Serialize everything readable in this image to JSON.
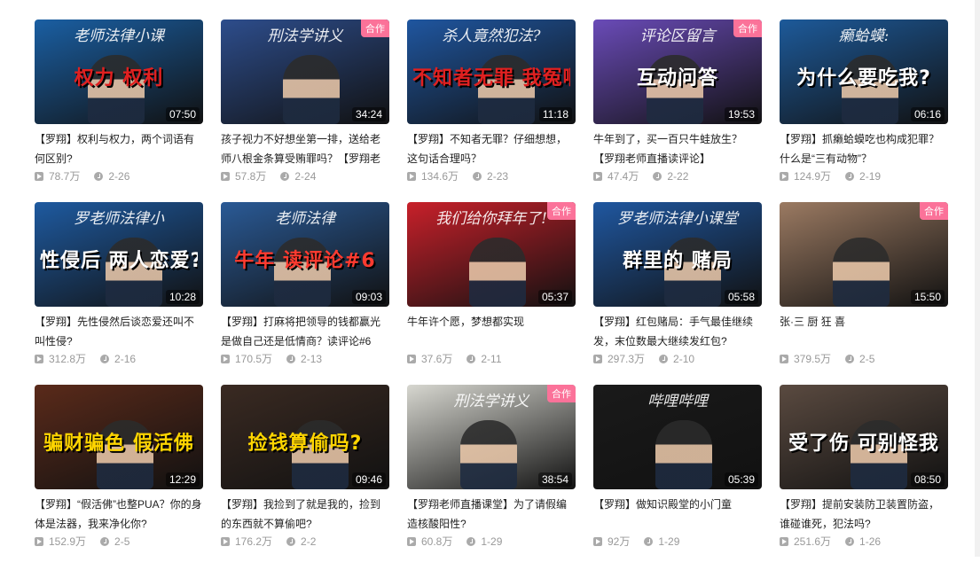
{
  "videos": [
    {
      "thumb_text_top": "老师法律小课",
      "thumb_caption": "权力  权利",
      "badge": "",
      "duration": "07:50",
      "title": "【罗翔】权利与权力，两个词语有何区别?",
      "views": "78.7万",
      "date": "2-26",
      "bg": "#1a5fa3",
      "cap_color": "#e02020"
    },
    {
      "thumb_text_top": "刑法学讲义",
      "thumb_caption": "",
      "badge": "合作",
      "duration": "34:24",
      "title": "孩子视力不好想坐第一排，送给老师八根金条算受贿罪吗？【罗翔老",
      "views": "57.8万",
      "date": "2-24",
      "bg": "#2d4d8c",
      "cap_color": "#ffffff"
    },
    {
      "thumb_text_top": "杀人竟然犯法?",
      "thumb_caption": "不知者无罪 我冤啊",
      "badge": "",
      "duration": "11:18",
      "title": "【罗翔】不知者无罪？仔细想想，这句话合理吗？",
      "views": "134.6万",
      "date": "2-23",
      "bg": "#1f56a0",
      "cap_color": "#e02020"
    },
    {
      "thumb_text_top": "评论区留言",
      "thumb_caption": "互动问答",
      "badge": "合作",
      "duration": "19:53",
      "title": "牛年到了，买一百只牛蛙放生？【罗翔老师直播读评论】",
      "views": "47.4万",
      "date": "2-22",
      "bg": "#6a4bb8",
      "cap_color": "#ffffff"
    },
    {
      "thumb_text_top": "癞蛤蟆:",
      "thumb_caption": "为什么要吃我?",
      "badge": "",
      "duration": "06:16",
      "title": "【罗翔】抓癞蛤蟆吃也构成犯罪？什么是“三有动物”？",
      "views": "124.9万",
      "date": "2-19",
      "bg": "#1d5a9a",
      "cap_color": "#ffffff"
    },
    {
      "thumb_text_top": "罗老师法律小",
      "thumb_caption": "性侵后 两人恋爱?",
      "badge": "",
      "duration": "10:28",
      "title": "【罗翔】先性侵然后谈恋爱还叫不叫性侵?",
      "views": "312.8万",
      "date": "2-16",
      "bg": "#1e5aa0",
      "cap_color": "#ffffff"
    },
    {
      "thumb_text_top": "老师法律",
      "thumb_caption": "牛年 读评论#6",
      "badge": "",
      "duration": "09:03",
      "title": "【罗翔】打麻将把领导的钱都赢光是做自己还是低情商？读评论#6",
      "views": "170.5万",
      "date": "2-13",
      "bg": "#2a5a96",
      "cap_color": "#ff3b30"
    },
    {
      "thumb_text_top": "我们给你拜年了!",
      "thumb_caption": "",
      "badge": "合作",
      "duration": "05:37",
      "title": "牛年许个愿，梦想都实现",
      "views": "37.6万",
      "date": "2-11",
      "bg": "#c8202a",
      "cap_color": "#ffe14a"
    },
    {
      "thumb_text_top": "罗老师法律小课堂",
      "thumb_caption": "群里的 赌局",
      "badge": "",
      "duration": "05:58",
      "title": "【罗翔】红包赌局：手气最佳继续发，末位数最大继续发红包?",
      "views": "297.3万",
      "date": "2-10",
      "bg": "#1f57a0",
      "cap_color": "#ffffff"
    },
    {
      "thumb_text_top": "",
      "thumb_caption": "",
      "badge": "合作",
      "duration": "15:50",
      "title": "张·三 厨 狂 喜",
      "views": "379.5万",
      "date": "2-5",
      "bg": "#9b7a62",
      "cap_color": "#ffffff"
    },
    {
      "thumb_text_top": "",
      "thumb_caption": "骗财骗色 假活佛",
      "badge": "",
      "duration": "12:29",
      "title": "【罗翔】“假活佛”也整PUA？你的身体是法器，我来净化你?",
      "views": "152.9万",
      "date": "2-5",
      "bg": "#5a2a1a",
      "cap_color": "#ffd500"
    },
    {
      "thumb_text_top": "",
      "thumb_caption": "捡钱算偷吗?",
      "badge": "",
      "duration": "09:46",
      "title": "【罗翔】我捡到了就是我的，捡到的东西就不算偷吧?",
      "views": "176.2万",
      "date": "2-2",
      "bg": "#3a2a22",
      "cap_color": "#ffd500"
    },
    {
      "thumb_text_top": "刑法学讲义",
      "thumb_caption": "",
      "badge": "合作",
      "duration": "38:54",
      "title": "【罗翔老师直播课堂】为了请假编造核酸阳性?",
      "views": "60.8万",
      "date": "1-29",
      "bg": "#d7d7d0",
      "cap_color": "#222222"
    },
    {
      "thumb_text_top": "哔哩哔哩",
      "thumb_caption": "",
      "badge": "",
      "duration": "05:39",
      "title": "【罗翔】做知识殿堂的小门童",
      "views": "92万",
      "date": "1-29",
      "bg": "#1a1a1a",
      "cap_color": "#ffffff"
    },
    {
      "thumb_text_top": "",
      "thumb_caption": "受了伤 可别怪我",
      "badge": "",
      "duration": "08:50",
      "title": "【罗翔】提前安装防卫装置防盗，谁碰谁死，犯法吗?",
      "views": "251.6万",
      "date": "1-26",
      "bg": "#5a4a40",
      "cap_color": "#ffffff"
    }
  ]
}
